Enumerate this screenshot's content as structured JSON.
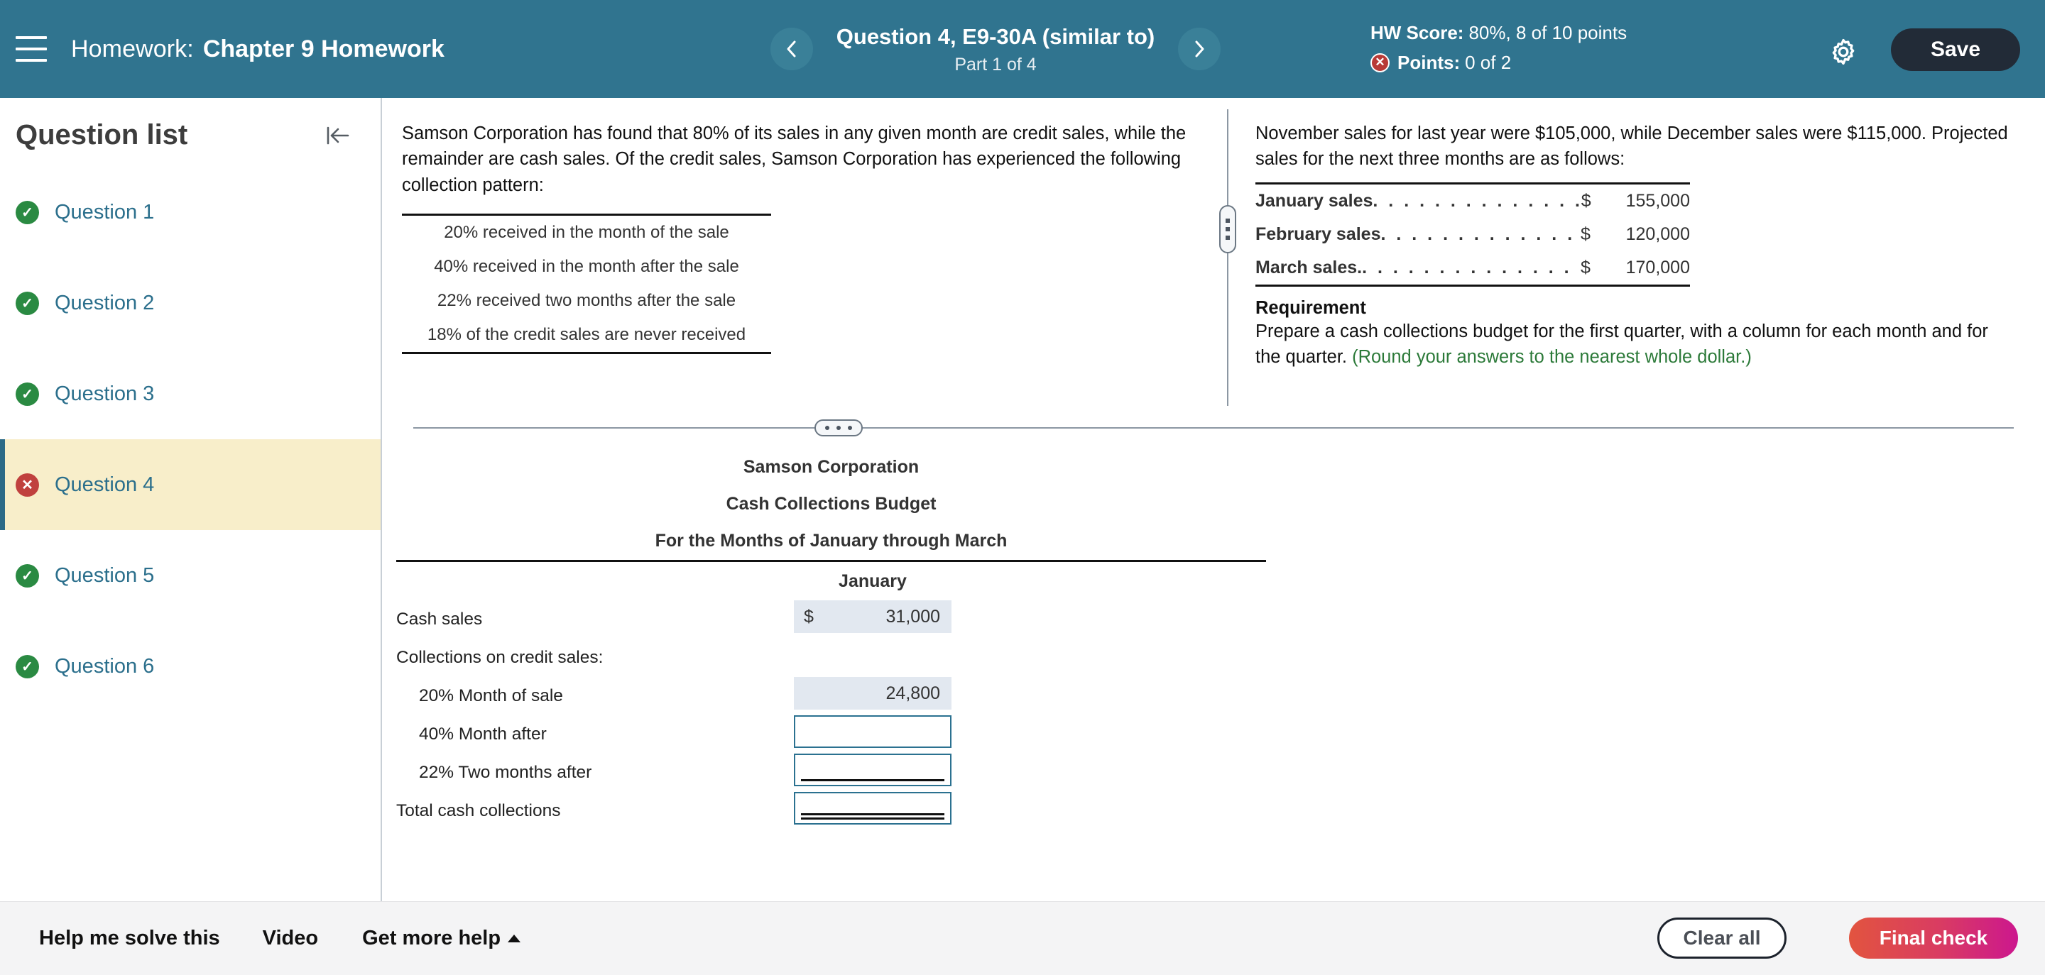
{
  "header": {
    "menu_icon": "hamburger-icon",
    "breadcrumb_label": "Homework:",
    "assignment_title": "Chapter 9 Homework",
    "prev_icon": "chevron-left-icon",
    "next_icon": "chevron-right-icon",
    "question_title": "Question 4, E9-30A (similar to)",
    "part_label": "Part 1 of 4",
    "hw_score_key": "HW Score:",
    "hw_score_value": "80%, 8 of 10 points",
    "points_key": "Points:",
    "points_value": "0 of 2",
    "points_status_icon": "error-x-icon",
    "settings_icon": "gear-icon",
    "save_label": "Save",
    "bar_color": "#30748f",
    "save_color": "#222b37"
  },
  "sidebar": {
    "title": "Question list",
    "collapse_icon": "collapse-left-icon",
    "items": [
      {
        "label": "Question 1",
        "status": "ok",
        "icon": "check-circle-icon",
        "active": false
      },
      {
        "label": "Question 2",
        "status": "ok",
        "icon": "check-circle-icon",
        "active": false
      },
      {
        "label": "Question 3",
        "status": "ok",
        "icon": "check-circle-icon",
        "active": false
      },
      {
        "label": "Question 4",
        "status": "bad",
        "icon": "error-x-circle-icon",
        "active": true
      },
      {
        "label": "Question 5",
        "status": "ok",
        "icon": "check-circle-icon",
        "active": false
      },
      {
        "label": "Question 6",
        "status": "ok",
        "icon": "check-circle-icon",
        "active": false
      }
    ],
    "active_highlight_color": "#f8eeca",
    "link_color": "#2b6f8c",
    "ok_color": "#2a8a42",
    "bad_color": "#c0413e"
  },
  "prompt": {
    "left_paragraph": "Samson Corporation has found that 80% of its sales in any given month are credit sales, while the remainder are cash sales. Of the credit sales, Samson Corporation has experienced the following collection pattern:",
    "collection_pattern": [
      "20% received in the month of the sale",
      "40% received in the month after the sale",
      "22% received two months after the sale",
      "18% of the credit sales are never received"
    ],
    "right_paragraph": "November sales for last year were $105,000, while December sales were $115,000. Projected sales for the next three months are as follows:",
    "projected_sales": [
      {
        "name": "January sales",
        "dots": ". . . . . . . . . . . . . .",
        "currency": "$",
        "value": "155,000"
      },
      {
        "name": "February sales",
        "dots": ". . . . . . . . . . . . .",
        "currency": "$",
        "value": "120,000"
      },
      {
        "name": "March sales.",
        "dots": ". . . . . . . . . . . . . .",
        "currency": "$",
        "value": "170,000"
      }
    ],
    "requirement_heading": "Requirement",
    "requirement_text": "Prepare a cash collections budget for the first quarter, with a column for each month and for the quarter. ",
    "requirement_note": "(Round your answers to the nearest whole dollar.)",
    "note_color": "#2c7a39",
    "v_splitter_icon": "vertical-drag-handle-icon",
    "h_splitter_icon": "horizontal-drag-handle-icon"
  },
  "worksheet": {
    "title_line1": "Samson Corporation",
    "title_line2": "Cash Collections Budget",
    "title_line3": "For the Months of January through March",
    "column_header": "January",
    "rows": [
      {
        "label": "Cash sales",
        "indent": 0,
        "type": "filled",
        "currency": "$",
        "value": "31,000",
        "rule": "none"
      },
      {
        "label": "Collections on credit sales:",
        "indent": 0,
        "type": "none",
        "currency": "",
        "value": "",
        "rule": "none"
      },
      {
        "label": "20% Month of sale",
        "indent": 1,
        "type": "filled",
        "currency": "",
        "value": "24,800",
        "rule": "none"
      },
      {
        "label": "40% Month after",
        "indent": 1,
        "type": "input",
        "currency": "",
        "value": "",
        "rule": "none"
      },
      {
        "label": "22% Two months after",
        "indent": 1,
        "type": "input",
        "currency": "",
        "value": "",
        "rule": "single"
      },
      {
        "label": "Total cash collections",
        "indent": 0,
        "type": "input",
        "currency": "",
        "value": "",
        "rule": "double"
      }
    ],
    "filled_cell_color": "#e2e8f0",
    "input_border_color": "#2b7190"
  },
  "footer": {
    "help_label": "Help me solve this",
    "video_label": "Video",
    "more_help_label": "Get more help",
    "more_help_icon": "caret-up-icon",
    "clear_label": "Clear all",
    "final_label": "Final check",
    "final_gradient_from": "#e2543f",
    "final_gradient_to": "#cc178e"
  }
}
